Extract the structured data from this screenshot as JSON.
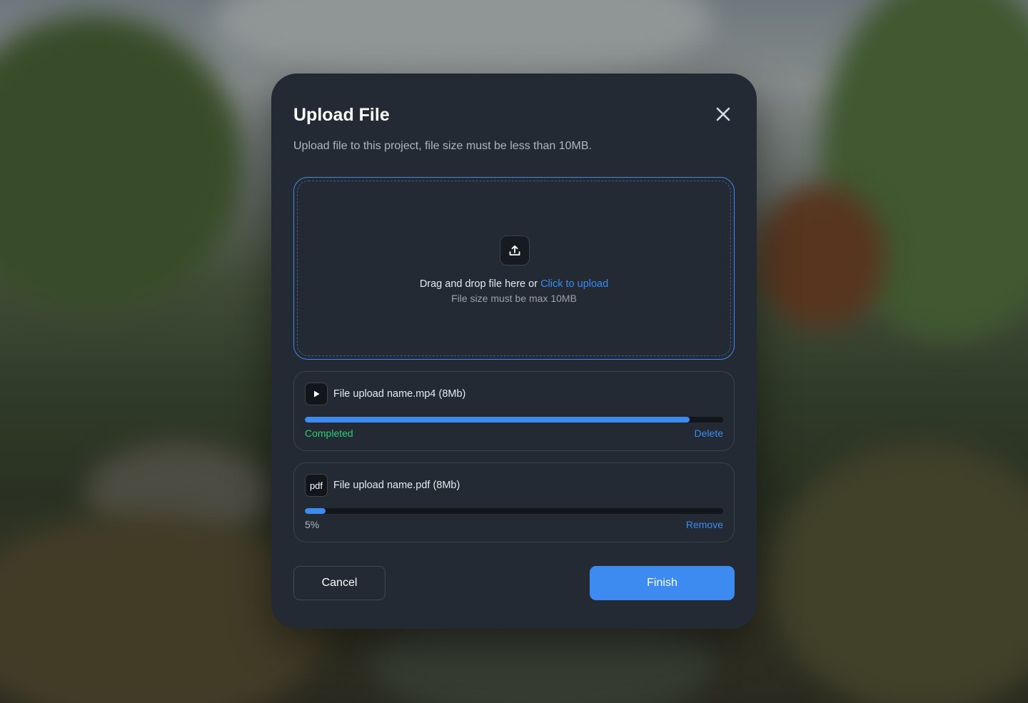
{
  "modal": {
    "title": "Upload File",
    "subtitle": "Upload file to this project, file size must be less than 10MB.",
    "close_icon": "close-icon"
  },
  "dropzone": {
    "icon": "upload-icon",
    "text": "Drag and drop file here or ",
    "link": "Click to upload",
    "hint": "File size must be max 10MB"
  },
  "files": [
    {
      "icon": "play-icon",
      "name": "File upload name.mp4 (8Mb)",
      "progress": 0.92,
      "status": "Completed",
      "status_color": "#2ecc71",
      "action": "Delete"
    },
    {
      "icon_label": "pdf",
      "name": "File upload name.pdf (8Mb)",
      "progress": 0.05,
      "status": "5%",
      "status_color": "#aeb6c0",
      "action": "Remove"
    }
  ],
  "footer": {
    "cancel": "Cancel",
    "finish": "Finish"
  },
  "colors": {
    "accent": "#3d8bf0",
    "modal_bg": "#232a33",
    "success": "#2ecc71"
  }
}
